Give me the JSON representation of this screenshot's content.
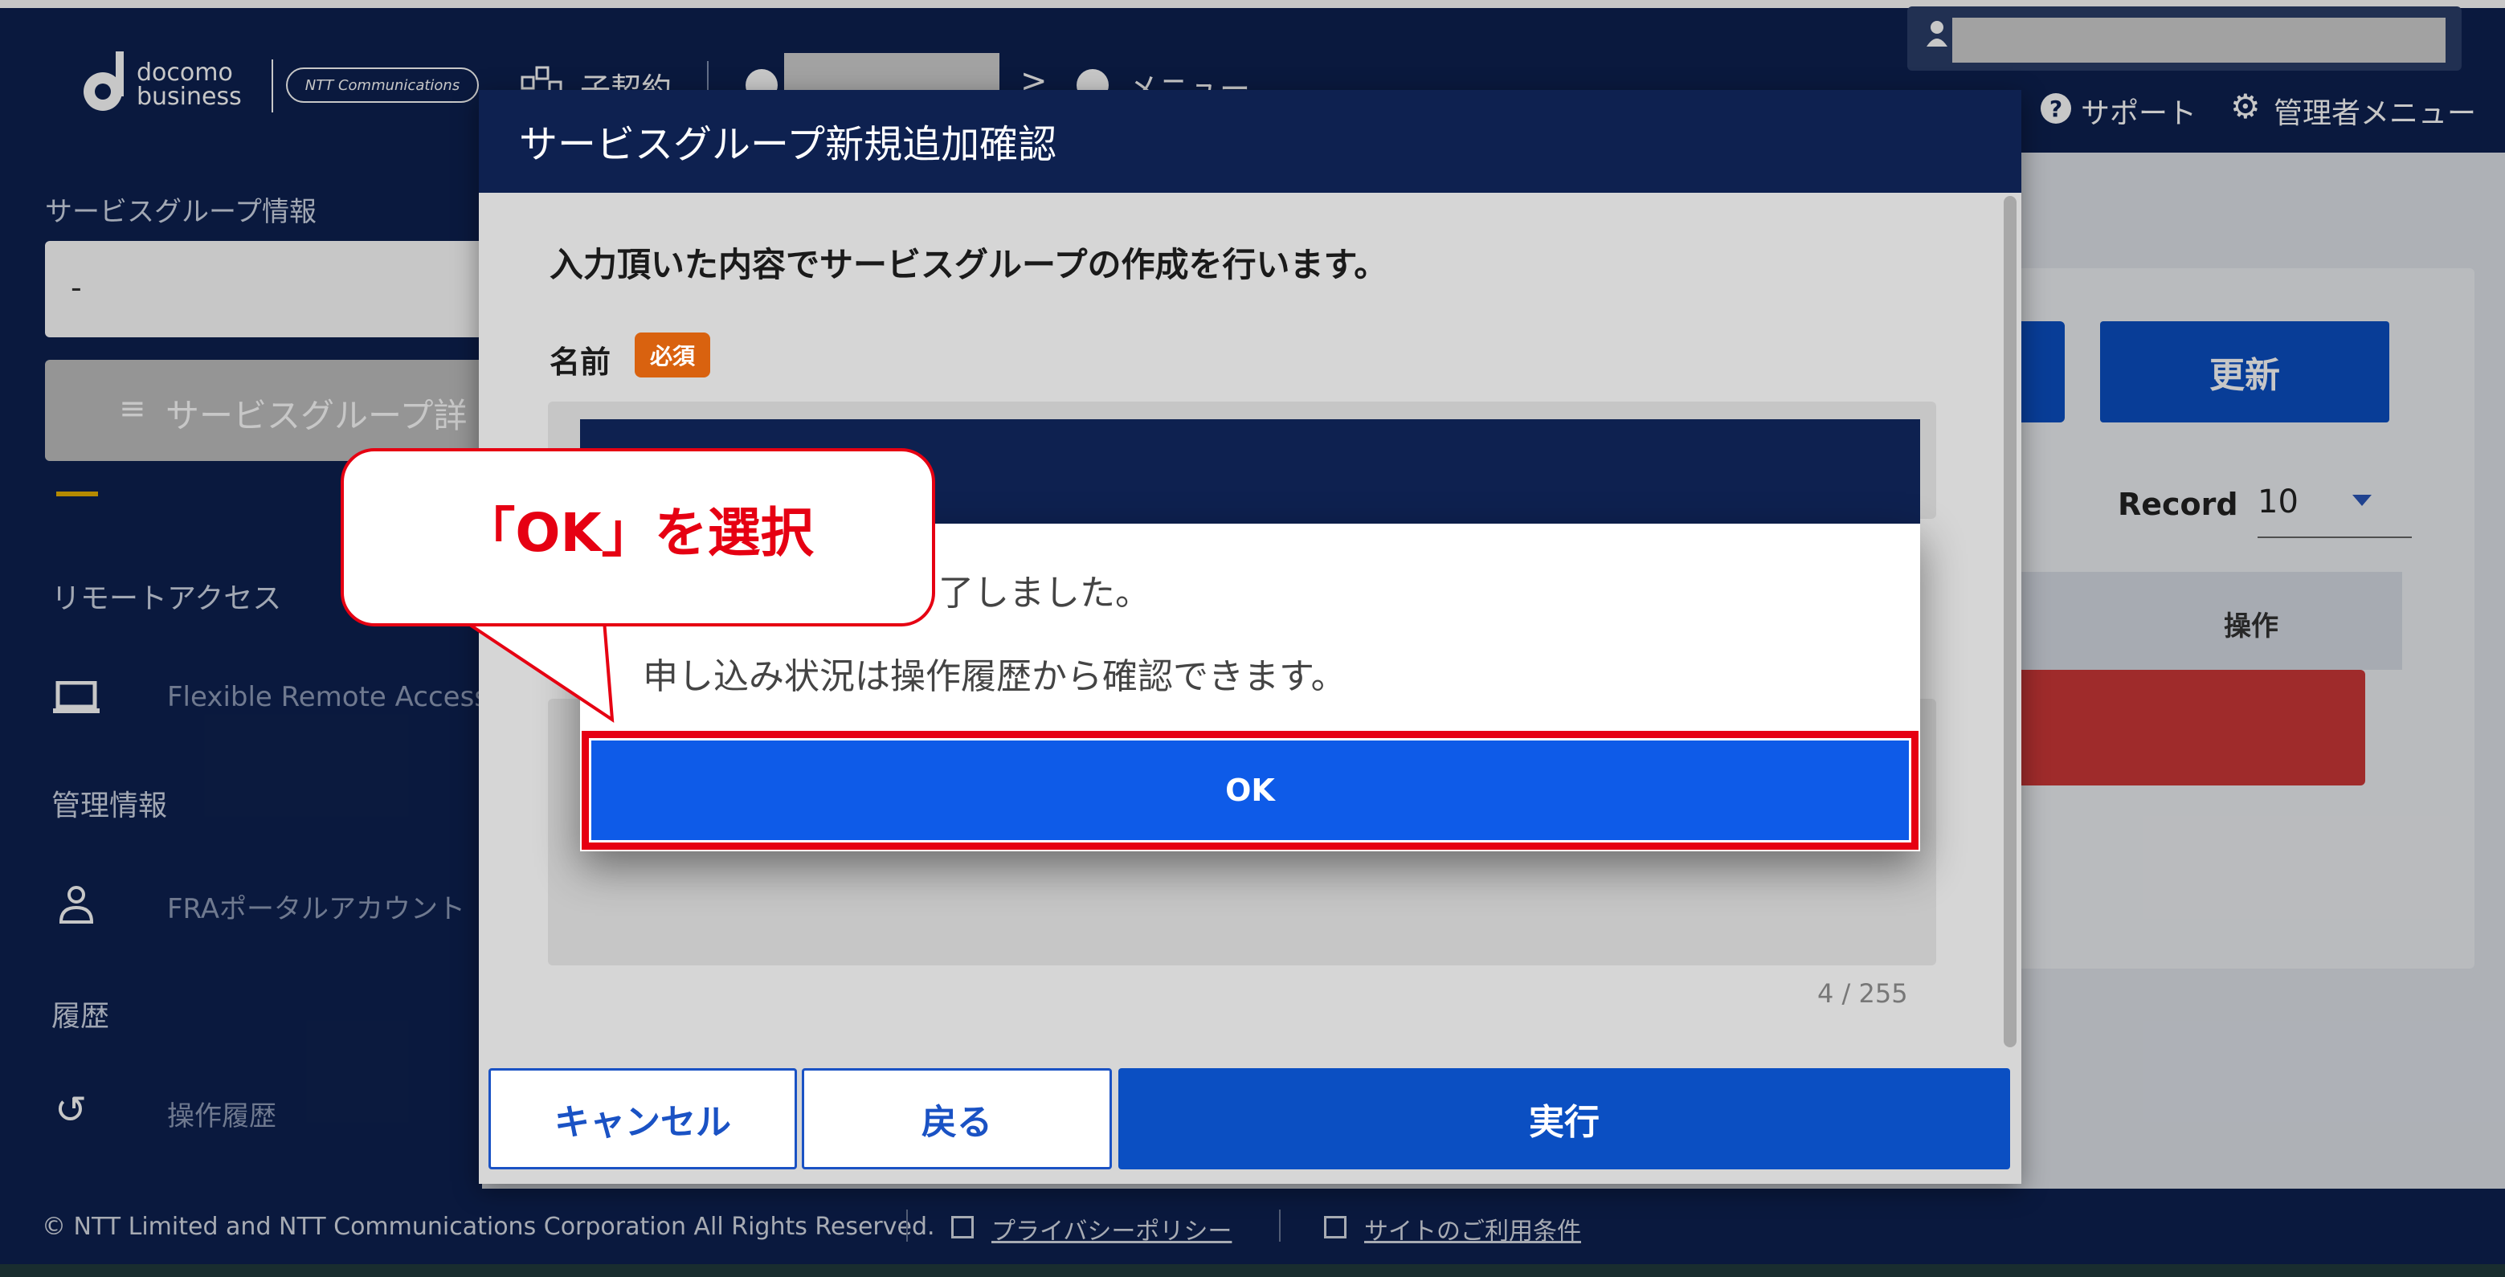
{
  "header": {
    "logo_line1": "docomo",
    "logo_line2": "business",
    "ntt_logo": "NTT Communications",
    "breadcrumb_contract": "子契約",
    "breadcrumb_menu": "メニュー",
    "support": "サポート",
    "admin_menu": "管理者メニュー"
  },
  "sidebar": {
    "service_group_section": "サービスグループ情報",
    "service_group_value": "-",
    "service_group_button": "サービスグループ詳",
    "remote_access_section": "リモートアクセス",
    "remote_item": "Flexible Remote Access",
    "manage_section": "管理情報",
    "manage_item": "FRAポータルアカウント",
    "history_section": "履歴",
    "history_item": "操作履歴"
  },
  "main": {
    "update_button": "更新",
    "record_label": "Record",
    "record_value": "10",
    "ops_header": "操作"
  },
  "footer": {
    "copyright": "© NTT Limited and NTT Communications Corporation All Rights Reserved.",
    "privacy": "プライバシーポリシー",
    "terms": "サイトのご利用条件"
  },
  "dialog1": {
    "title": "サービスグループ新規追加確認",
    "message": "入力頂いた内容でサービスグループの作成を行います。",
    "name_label": "名前",
    "required_badge": "必須",
    "char_count": "4 / 255",
    "cancel": "キャンセル",
    "back": "戻る",
    "execute": "実行"
  },
  "dialog2": {
    "message_partial": "了しました。",
    "message2": "申し込み状況は操作履歴から確認できます。",
    "ok": "OK"
  },
  "callout": {
    "text": "「OK」を選択"
  },
  "colors": {
    "navy": "#0e2150",
    "primary": "#0b4fc2",
    "ok_blue": "#0e5be8",
    "highlight_red": "#e60012",
    "badge_orange": "#d9620f"
  }
}
